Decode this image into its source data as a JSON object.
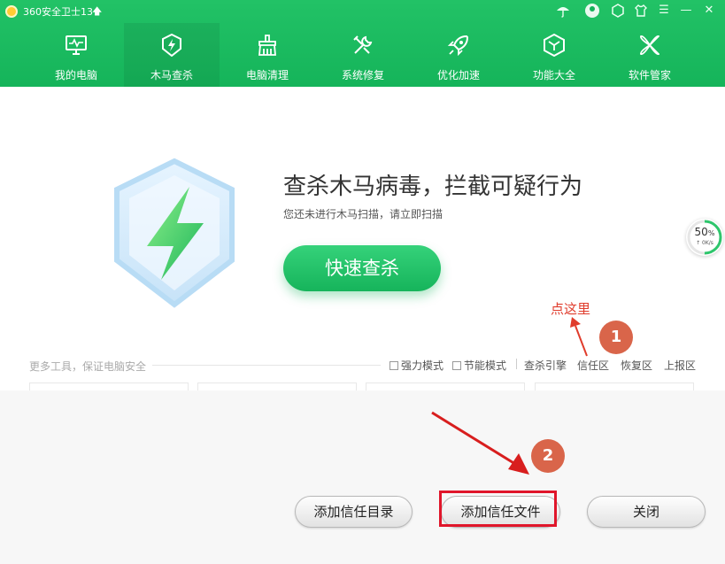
{
  "app": {
    "title": "360安全卫士13",
    "title_arrow": "🡅"
  },
  "window_controls": {
    "skin_icon": "umbrella-icon",
    "avatar_icon": "user-avatar-icon",
    "hex_icon": "hexagon-icon",
    "shirt_icon": "shirt-icon",
    "menu_glyph": "☰",
    "minimize_glyph": "—",
    "close_glyph": "✕"
  },
  "nav": [
    {
      "label": "我的电脑",
      "icon": "monitor-icon"
    },
    {
      "label": "木马查杀",
      "icon": "shield-bolt-icon",
      "active": true
    },
    {
      "label": "电脑清理",
      "icon": "broom-icon"
    },
    {
      "label": "系统修复",
      "icon": "wrench-icon"
    },
    {
      "label": "优化加速",
      "icon": "rocket-icon"
    },
    {
      "label": "功能大全",
      "icon": "cube-icon"
    },
    {
      "label": "软件管家",
      "icon": "flower-icon"
    }
  ],
  "hero": {
    "title": "查杀木马病毒，拦截可疑行为",
    "subtitle": "您还未进行木马扫描，请立即扫描",
    "scan_button": "快速查杀"
  },
  "speed_widget": {
    "percent": "50",
    "percent_sign": "%",
    "rate": "↑ 0K/s",
    "progress": 0.5
  },
  "annotations": {
    "hint": "点这里",
    "step1": "1",
    "step2": "2"
  },
  "tools": {
    "label": "更多工具，保证电脑安全",
    "strong_mode": "强力模式",
    "power_mode": "节能模式",
    "engine": "查杀引擎",
    "trust_zone": "信任区",
    "restore_zone": "恢复区",
    "report_zone": "上报区"
  },
  "dialog": {
    "add_trust_dir": "添加信任目录",
    "add_trust_file": "添加信任文件",
    "close": "关闭"
  },
  "colors": {
    "brand_green": "#16b45b",
    "annotation_red": "#e03c2c",
    "step_circle": "#d9654a"
  }
}
